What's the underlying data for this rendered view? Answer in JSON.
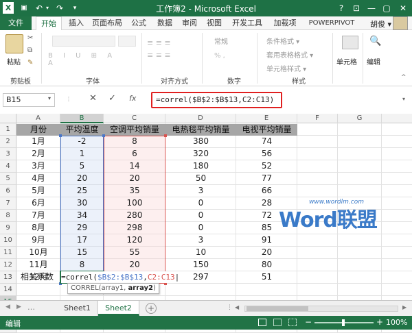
{
  "window": {
    "title": "工作簿2 - Microsoft Excel",
    "help": "?",
    "min": "—",
    "max": "▢",
    "close": "✕",
    "ribbon_opts": "⊡"
  },
  "quick_access": {
    "undo": "↶",
    "redo": "↷",
    "more": "▾",
    "save": "💾"
  },
  "tabs": {
    "file": "文件",
    "items": [
      "开始",
      "插入",
      "页面布局",
      "公式",
      "数据",
      "审阅",
      "视图",
      "开发工具",
      "加载项",
      "POWERPIVOT"
    ],
    "active": "开始"
  },
  "user": "胡俊 ▾",
  "ribbon": {
    "clipboard": {
      "paste": "粘贴",
      "label": "剪贴板"
    },
    "font": {
      "label": "字体",
      "font_name": "",
      "font_size": ""
    },
    "alignment": {
      "label": "对齐方式",
      "button": "对齐方式"
    },
    "number": {
      "label": "数字",
      "format": "常规"
    },
    "styles": {
      "label": "样式",
      "conditional": "条件格式 ▾",
      "table": "套用表格格式 ▾",
      "cell": "单元格样式 ▾"
    },
    "cells": {
      "label": "单元格"
    },
    "editing": {
      "label": "编辑"
    }
  },
  "formula_bar": {
    "name_box": "B15",
    "cancel": "✕",
    "enter": "✓",
    "fx": "fx",
    "formula": "=correl($B$2:$B$13,C2:C13)"
  },
  "columns": [
    "A",
    "B",
    "C",
    "D",
    "E",
    "F",
    "G"
  ],
  "rows": [
    "1",
    "2",
    "3",
    "4",
    "5",
    "6",
    "7",
    "8",
    "9",
    "10",
    "11",
    "12",
    "13",
    "14",
    "15",
    "16",
    "17"
  ],
  "table": {
    "headers": [
      "月份",
      "平均温度",
      "空调平均销量",
      "电热毯平均销量",
      "电视平均销量"
    ],
    "data": [
      [
        "1月",
        "-2",
        "8",
        "380",
        "74"
      ],
      [
        "2月",
        "1",
        "6",
        "320",
        "56"
      ],
      [
        "3月",
        "5",
        "14",
        "180",
        "52"
      ],
      [
        "4月",
        "20",
        "20",
        "50",
        "77"
      ],
      [
        "5月",
        "25",
        "35",
        "3",
        "66"
      ],
      [
        "6月",
        "30",
        "100",
        "0",
        "28"
      ],
      [
        "7月",
        "34",
        "280",
        "0",
        "72"
      ],
      [
        "8月",
        "29",
        "298",
        "0",
        "85"
      ],
      [
        "9月",
        "17",
        "120",
        "3",
        "91"
      ],
      [
        "10月",
        "15",
        "55",
        "10",
        "20"
      ],
      [
        "11月",
        "8",
        "20",
        "150",
        "80"
      ],
      [
        "12月",
        "0",
        "5",
        "297",
        "51"
      ]
    ]
  },
  "row15": {
    "label": "相关系数",
    "formula_start": "=correl(",
    "ref1": "$B$2:$B$13",
    "comma": ",",
    "ref2": "C2:C13",
    "cursor": "|"
  },
  "tooltip": {
    "prefix": "CORREL(array1, ",
    "bold": "array2",
    ")": ")"
  },
  "sheets": [
    "Sheet1",
    "Sheet2"
  ],
  "active_sheet": "Sheet2",
  "status": {
    "mode": "编辑",
    "zoom": "100%",
    "minus": "−",
    "plus": "+"
  },
  "watermark": {
    "text": "Word联盟",
    "url": "www.wordlm.com"
  },
  "colors": {
    "excel_green": "#217346",
    "ref1": "#4a76c8",
    "ref2": "#d9534f",
    "highlight_red": "#e02020"
  }
}
